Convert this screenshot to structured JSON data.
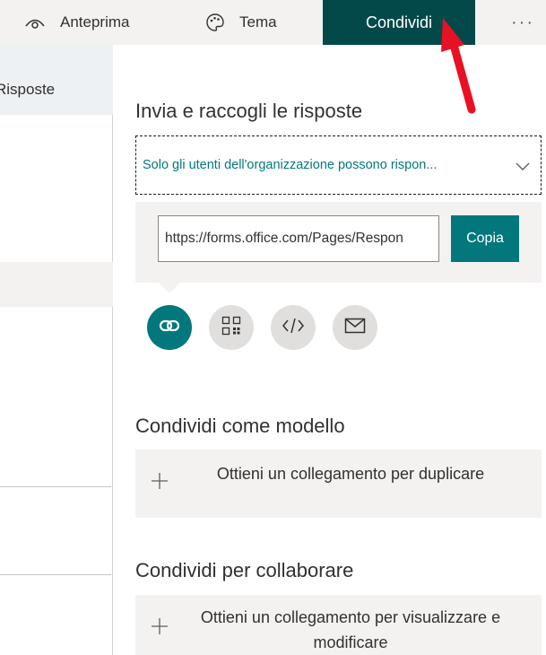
{
  "topbar": {
    "preview_label": "Anteprima",
    "theme_label": "Tema",
    "share_label": "Condividi",
    "more_label": "···"
  },
  "sidebar": {
    "tab_label": "Risposte"
  },
  "share_panel": {
    "send_title": "Invia e raccogli le risposte",
    "permission": {
      "selected": "Solo gli utenti dell'organizzazione possono rispon..."
    },
    "link": {
      "url": "https://forms.office.com/Pages/Respon",
      "copy_label": "Copia"
    },
    "methods": [
      {
        "icon": "link-icon",
        "active": true
      },
      {
        "icon": "qr-code-icon",
        "active": false
      },
      {
        "icon": "embed-code-icon",
        "active": false
      },
      {
        "icon": "email-icon",
        "active": false
      }
    ],
    "template": {
      "title": "Condividi come modello",
      "action_label": "Ottieni un collegamento per duplicare"
    },
    "collaborate": {
      "title": "Condividi per collaborare",
      "action_label": "Ottieni un collegamento per visualizzare e modificare"
    }
  },
  "colors": {
    "share_tab_bg": "#03494a",
    "accent": "#03787c",
    "annotation_arrow": "#e81123"
  }
}
